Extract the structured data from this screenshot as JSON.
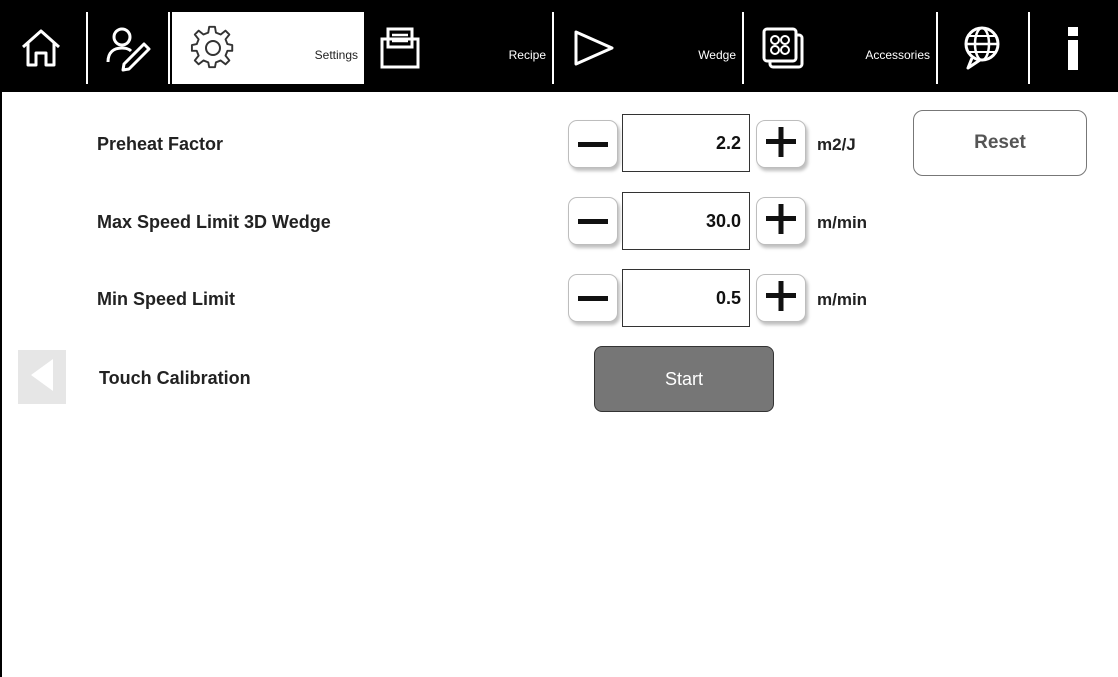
{
  "nav": {
    "tabs": [
      {
        "label": "",
        "icon": "home-icon"
      },
      {
        "label": "",
        "icon": "user-edit-icon"
      },
      {
        "label": "Settings",
        "icon": "gear-icon",
        "active": true
      },
      {
        "label": "Recipe",
        "icon": "recipe-icon"
      },
      {
        "label": "Wedge",
        "icon": "play-triangle-icon"
      },
      {
        "label": "Accessories",
        "icon": "accessories-icon"
      },
      {
        "label": "",
        "icon": "globe-icon"
      },
      {
        "label": "",
        "icon": "info-icon"
      }
    ]
  },
  "settings": {
    "rows": [
      {
        "label": "Preheat Factor",
        "value": "2.2",
        "unit": "m2/J"
      },
      {
        "label": "Max Speed Limit 3D Wedge",
        "value": "30.0",
        "unit": "m/min"
      },
      {
        "label": "Min Speed Limit",
        "value": "0.5",
        "unit": "m/min"
      },
      {
        "label": "Touch Calibration"
      }
    ],
    "reset_label": "Reset",
    "start_label": "Start"
  },
  "colors": {
    "bar": "#000000",
    "start_button": "#767676",
    "arrow_panel": "#e6e6e6"
  }
}
